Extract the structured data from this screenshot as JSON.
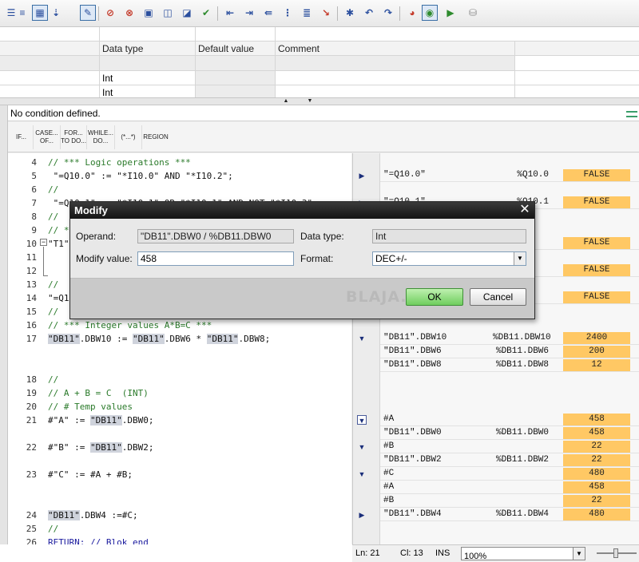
{
  "toolbar": {
    "icons": [
      "list-icon",
      "block-list-icon",
      "insert-icon",
      "edit-active-icon",
      "stop-icon",
      "clear-icon",
      "monitor-icon",
      "load-icon",
      "load-2-icon",
      "check-icon",
      "indent-in-icon",
      "indent-out-icon",
      "align-icon",
      "list-2-icon",
      "go-to-icon",
      "breakpoint-icon",
      "step-icon",
      "step-back-icon",
      "compare-icon",
      "monitor-on-icon",
      "monitor-step-icon",
      "database-icon"
    ]
  },
  "interface": {
    "headers": {
      "data_type": "Data type",
      "default_value": "Default value",
      "comment": "Comment"
    },
    "rows": [
      {
        "data_type": "Int"
      },
      {
        "data_type": "Int"
      }
    ]
  },
  "condition": {
    "text": "No condition defined."
  },
  "snippets": [
    "IF...",
    "CASE... OF...",
    "FOR... TO DO...",
    "WHILE... DO...",
    "(*...*)",
    "REGION"
  ],
  "code": {
    "lines": [
      {
        "n": "4",
        "text": "// *** Logic operations ***"
      },
      {
        "n": "5",
        "text": " \"=Q10.0\" := \"*I10.0\" AND \"*I10.2\";"
      },
      {
        "n": "6",
        "text": "//"
      },
      {
        "n": "7",
        "text": " \"=Q10.1\" := \"*I10.1\" OR \"*I10.1\" AND NOT \"*I10.3\";"
      },
      {
        "n": "8",
        "text": "//"
      },
      {
        "n": "9",
        "text": "// *"
      },
      {
        "n": "10",
        "text": "\"T1\""
      },
      {
        "n": "11",
        "text": ""
      },
      {
        "n": "12",
        "text": ""
      },
      {
        "n": "13",
        "text": "//"
      },
      {
        "n": "14",
        "text": "\"=Q1"
      },
      {
        "n": "15",
        "text": "//"
      },
      {
        "n": "16",
        "text": "// *** Integer values A*B=C ***"
      },
      {
        "n": "17",
        "text": "\"DB11\".DBW10 := \"DB11\".DBW6 * \"DB11\".DBW8;"
      },
      {
        "n": "18",
        "text": "//"
      },
      {
        "n": "19",
        "text": "// A + B = C  (INT)"
      },
      {
        "n": "20",
        "text": "// # Temp values"
      },
      {
        "n": "21",
        "text": "#\"A\" := \"DB11\".DBW0;"
      },
      {
        "n": "22",
        "text": "#\"B\" := \"DB11\".DBW2;"
      },
      {
        "n": "23",
        "text": "#\"C\" := #A + #B;"
      },
      {
        "n": "24",
        "text": "\"DB11\".DBW4 :=#C;"
      },
      {
        "n": "25",
        "text": "//"
      },
      {
        "n": "26",
        "text": "RETURN; // Blok end"
      }
    ],
    "hl_db": "\"DB11\"",
    "l17_tail1": ".DBW10 := ",
    "l17_tail2": ".DBW6 * ",
    "l17_tail3": ".DBW8;",
    "l21_head": "#\"A\" := ",
    "l21_tail": ".DBW0;",
    "l22_head": "#\"B\" := ",
    "l22_tail": ".DBW2;",
    "l24_tail": ".DBW4 :=#C;"
  },
  "monitor": {
    "rows": [
      {
        "op": "\"=Q10.0\"",
        "addr": "%Q10.0",
        "val": "FALSE"
      },
      {
        "op": "\"=Q10.1\"",
        "addr": "%Q10.1",
        "val": "FALSE"
      },
      {
        "op": "",
        "addr": "",
        "val": "FALSE"
      },
      {
        "op": "",
        "addr": "",
        "val": "FALSE"
      },
      {
        "op": "",
        "addr": "",
        "val": "FALSE"
      },
      {
        "op": "\"DB11\".DBW10",
        "addr": "%DB11.DBW10",
        "val": "2400"
      },
      {
        "op": "\"DB11\".DBW6",
        "addr": "%DB11.DBW6",
        "val": "200"
      },
      {
        "op": "\"DB11\".DBW8",
        "addr": "%DB11.DBW8",
        "val": "12"
      },
      {
        "op": "#A",
        "addr": "",
        "val": "458"
      },
      {
        "op": "\"DB11\".DBW0",
        "addr": "%DB11.DBW0",
        "val": "458"
      },
      {
        "op": "#B",
        "addr": "",
        "val": "22"
      },
      {
        "op": "\"DB11\".DBW2",
        "addr": "%DB11.DBW2",
        "val": "22"
      },
      {
        "op": "#C",
        "addr": "",
        "val": "480"
      },
      {
        "op": "#A",
        "addr": "",
        "val": "458"
      },
      {
        "op": "#B",
        "addr": "",
        "val": "22"
      },
      {
        "op": "\"DB11\".DBW4",
        "addr": "%DB11.DBW4",
        "val": "480"
      }
    ]
  },
  "status": {
    "line": "Ln: 21",
    "col": "Cl: 13",
    "mode": "INS",
    "zoom": "100%"
  },
  "dialog": {
    "title": "Modify",
    "operand_label": "Operand:",
    "operand_value": "\"DB11\".DBW0 / %DB11.DBW0",
    "datatype_label": "Data type:",
    "datatype_value": "Int",
    "modify_label": "Modify value:",
    "modify_value": "458",
    "format_label": "Format:",
    "format_value": "DEC+/-",
    "watermark": "BLAJA.cz",
    "ok": "OK",
    "cancel": "Cancel",
    "close": "✕"
  },
  "colors": {
    "value_bg": "#ffc864",
    "ok_green": "#6fce5e",
    "title_bar": "#1e1e1e",
    "highlight": "#cfd3dc"
  }
}
